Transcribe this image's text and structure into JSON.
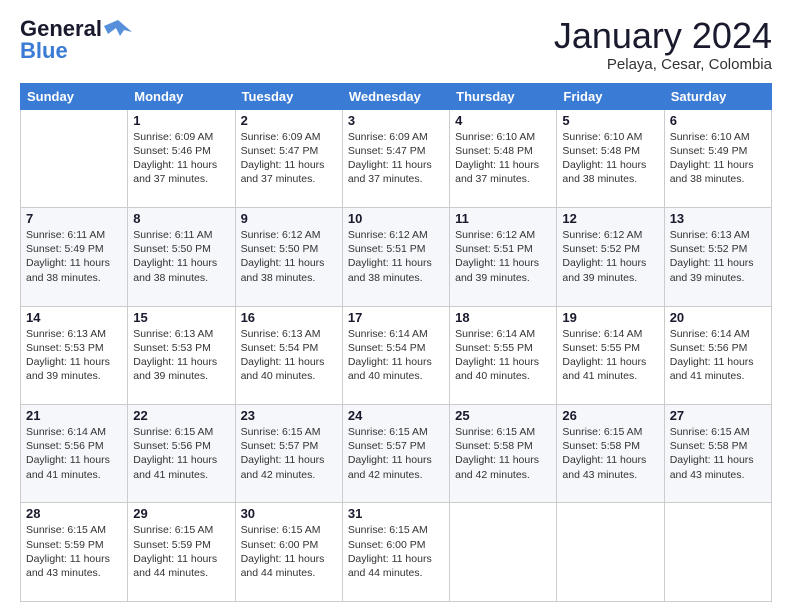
{
  "header": {
    "logo_line1": "General",
    "logo_line2": "Blue",
    "title": "January 2024",
    "subtitle": "Pelaya, Cesar, Colombia"
  },
  "days_of_week": [
    "Sunday",
    "Monday",
    "Tuesday",
    "Wednesday",
    "Thursday",
    "Friday",
    "Saturday"
  ],
  "weeks": [
    [
      {
        "day": "",
        "info": ""
      },
      {
        "day": "1",
        "info": "Sunrise: 6:09 AM\nSunset: 5:46 PM\nDaylight: 11 hours and 37 minutes."
      },
      {
        "day": "2",
        "info": "Sunrise: 6:09 AM\nSunset: 5:47 PM\nDaylight: 11 hours and 37 minutes."
      },
      {
        "day": "3",
        "info": "Sunrise: 6:09 AM\nSunset: 5:47 PM\nDaylight: 11 hours and 37 minutes."
      },
      {
        "day": "4",
        "info": "Sunrise: 6:10 AM\nSunset: 5:48 PM\nDaylight: 11 hours and 37 minutes."
      },
      {
        "day": "5",
        "info": "Sunrise: 6:10 AM\nSunset: 5:48 PM\nDaylight: 11 hours and 38 minutes."
      },
      {
        "day": "6",
        "info": "Sunrise: 6:10 AM\nSunset: 5:49 PM\nDaylight: 11 hours and 38 minutes."
      }
    ],
    [
      {
        "day": "7",
        "info": "Sunrise: 6:11 AM\nSunset: 5:49 PM\nDaylight: 11 hours and 38 minutes."
      },
      {
        "day": "8",
        "info": "Sunrise: 6:11 AM\nSunset: 5:50 PM\nDaylight: 11 hours and 38 minutes."
      },
      {
        "day": "9",
        "info": "Sunrise: 6:12 AM\nSunset: 5:50 PM\nDaylight: 11 hours and 38 minutes."
      },
      {
        "day": "10",
        "info": "Sunrise: 6:12 AM\nSunset: 5:51 PM\nDaylight: 11 hours and 38 minutes."
      },
      {
        "day": "11",
        "info": "Sunrise: 6:12 AM\nSunset: 5:51 PM\nDaylight: 11 hours and 39 minutes."
      },
      {
        "day": "12",
        "info": "Sunrise: 6:12 AM\nSunset: 5:52 PM\nDaylight: 11 hours and 39 minutes."
      },
      {
        "day": "13",
        "info": "Sunrise: 6:13 AM\nSunset: 5:52 PM\nDaylight: 11 hours and 39 minutes."
      }
    ],
    [
      {
        "day": "14",
        "info": "Sunrise: 6:13 AM\nSunset: 5:53 PM\nDaylight: 11 hours and 39 minutes."
      },
      {
        "day": "15",
        "info": "Sunrise: 6:13 AM\nSunset: 5:53 PM\nDaylight: 11 hours and 39 minutes."
      },
      {
        "day": "16",
        "info": "Sunrise: 6:13 AM\nSunset: 5:54 PM\nDaylight: 11 hours and 40 minutes."
      },
      {
        "day": "17",
        "info": "Sunrise: 6:14 AM\nSunset: 5:54 PM\nDaylight: 11 hours and 40 minutes."
      },
      {
        "day": "18",
        "info": "Sunrise: 6:14 AM\nSunset: 5:55 PM\nDaylight: 11 hours and 40 minutes."
      },
      {
        "day": "19",
        "info": "Sunrise: 6:14 AM\nSunset: 5:55 PM\nDaylight: 11 hours and 41 minutes."
      },
      {
        "day": "20",
        "info": "Sunrise: 6:14 AM\nSunset: 5:56 PM\nDaylight: 11 hours and 41 minutes."
      }
    ],
    [
      {
        "day": "21",
        "info": "Sunrise: 6:14 AM\nSunset: 5:56 PM\nDaylight: 11 hours and 41 minutes."
      },
      {
        "day": "22",
        "info": "Sunrise: 6:15 AM\nSunset: 5:56 PM\nDaylight: 11 hours and 41 minutes."
      },
      {
        "day": "23",
        "info": "Sunrise: 6:15 AM\nSunset: 5:57 PM\nDaylight: 11 hours and 42 minutes."
      },
      {
        "day": "24",
        "info": "Sunrise: 6:15 AM\nSunset: 5:57 PM\nDaylight: 11 hours and 42 minutes."
      },
      {
        "day": "25",
        "info": "Sunrise: 6:15 AM\nSunset: 5:58 PM\nDaylight: 11 hours and 42 minutes."
      },
      {
        "day": "26",
        "info": "Sunrise: 6:15 AM\nSunset: 5:58 PM\nDaylight: 11 hours and 43 minutes."
      },
      {
        "day": "27",
        "info": "Sunrise: 6:15 AM\nSunset: 5:58 PM\nDaylight: 11 hours and 43 minutes."
      }
    ],
    [
      {
        "day": "28",
        "info": "Sunrise: 6:15 AM\nSunset: 5:59 PM\nDaylight: 11 hours and 43 minutes."
      },
      {
        "day": "29",
        "info": "Sunrise: 6:15 AM\nSunset: 5:59 PM\nDaylight: 11 hours and 44 minutes."
      },
      {
        "day": "30",
        "info": "Sunrise: 6:15 AM\nSunset: 6:00 PM\nDaylight: 11 hours and 44 minutes."
      },
      {
        "day": "31",
        "info": "Sunrise: 6:15 AM\nSunset: 6:00 PM\nDaylight: 11 hours and 44 minutes."
      },
      {
        "day": "",
        "info": ""
      },
      {
        "day": "",
        "info": ""
      },
      {
        "day": "",
        "info": ""
      }
    ]
  ]
}
